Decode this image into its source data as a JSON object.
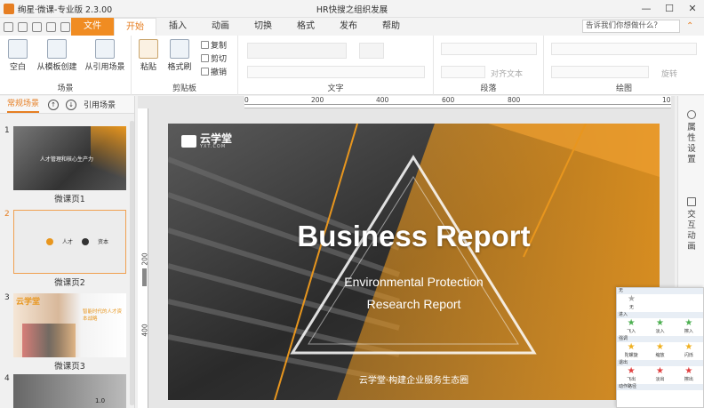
{
  "app": {
    "title": "绚星·微课-专业版 2.3.00",
    "doc_title": "HR快搜之组织发展"
  },
  "window": {
    "minimize": "—",
    "maximize": "☐",
    "close": "✕"
  },
  "menu": {
    "tabs": [
      "文件",
      "开始",
      "插入",
      "动画",
      "切换",
      "格式",
      "发布",
      "帮助"
    ],
    "active_index": 1,
    "ask_placeholder": "告诉我们你想做什么？"
  },
  "ribbon": {
    "scene": {
      "label": "场景",
      "buttons": [
        "空白",
        "从模板创建",
        "从引用场景"
      ]
    },
    "clipboard": {
      "label": "剪贴板",
      "big": [
        "粘贴",
        "格式刷"
      ],
      "small": [
        "复制",
        "剪切",
        "撤销"
      ]
    },
    "text": {
      "label": "文字"
    },
    "paragraph": {
      "label": "段落",
      "align_text": "对齐文本"
    },
    "drawing": {
      "label": "绘图",
      "rotate": "旋转"
    }
  },
  "left_pane": {
    "tabs": [
      "常规场景",
      "引用场景"
    ],
    "slides": [
      {
        "num": "1",
        "caption": "微课页1",
        "thumb_text": "人才管理和核心生产力"
      },
      {
        "num": "2",
        "caption": "微课页2",
        "thumb_items": [
          "人才",
          "资本"
        ]
      },
      {
        "num": "3",
        "caption": "微课页3",
        "thumb_logo": "云学堂",
        "thumb_heading": "智能时代的人才资本战略"
      },
      {
        "num": "4",
        "caption": "",
        "thumb_text": "1.0"
      }
    ]
  },
  "ruler": {
    "h_labels": [
      "0",
      "200",
      "400",
      "600",
      "800",
      "10"
    ],
    "v_labels": [
      "200",
      "400"
    ]
  },
  "slide": {
    "logo_text": "云学堂",
    "logo_sub": "YXT.COM",
    "title": "Business Report",
    "subtitle_1": "Environmental Protection",
    "subtitle_2": "Research Report",
    "footer": "云学堂·构建企业服务生态圈",
    "accent_color": "#e8961e"
  },
  "right_bar": {
    "items": [
      "属性设置",
      "交互动画"
    ]
  },
  "anim_panel": {
    "sections": [
      {
        "title": "无",
        "items": [
          "无"
        ]
      },
      {
        "title": "进入",
        "items": [
          "飞入",
          "淡入",
          "擦入"
        ]
      },
      {
        "title": "强调",
        "items": [
          "陀螺旋",
          "缩放",
          "闪烁"
        ]
      },
      {
        "title": "退出",
        "items": [
          "飞出",
          "淡出",
          "擦出"
        ]
      },
      {
        "title": "动作路径",
        "items": []
      }
    ]
  }
}
